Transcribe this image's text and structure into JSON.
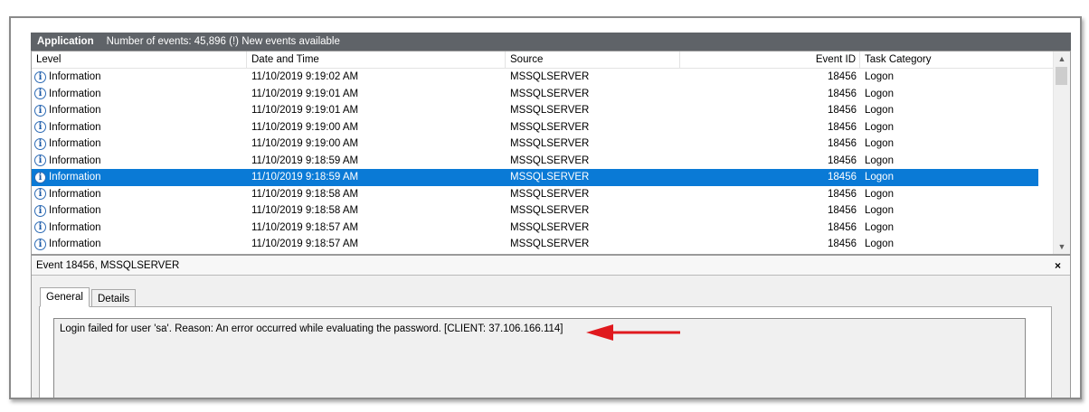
{
  "header": {
    "title": "Application",
    "subtitle": "Number of events: 45,896 (!) New events available"
  },
  "columns": {
    "level": "Level",
    "datetime": "Date and Time",
    "source": "Source",
    "event_id": "Event ID",
    "task_category": "Task Category"
  },
  "rows": [
    {
      "level": "Information",
      "datetime": "11/10/2019 9:19:02 AM",
      "source": "MSSQLSERVER",
      "event_id": "18456",
      "category": "Logon"
    },
    {
      "level": "Information",
      "datetime": "11/10/2019 9:19:01 AM",
      "source": "MSSQLSERVER",
      "event_id": "18456",
      "category": "Logon"
    },
    {
      "level": "Information",
      "datetime": "11/10/2019 9:19:01 AM",
      "source": "MSSQLSERVER",
      "event_id": "18456",
      "category": "Logon"
    },
    {
      "level": "Information",
      "datetime": "11/10/2019 9:19:00 AM",
      "source": "MSSQLSERVER",
      "event_id": "18456",
      "category": "Logon"
    },
    {
      "level": "Information",
      "datetime": "11/10/2019 9:19:00 AM",
      "source": "MSSQLSERVER",
      "event_id": "18456",
      "category": "Logon"
    },
    {
      "level": "Information",
      "datetime": "11/10/2019 9:18:59 AM",
      "source": "MSSQLSERVER",
      "event_id": "18456",
      "category": "Logon"
    },
    {
      "level": "Information",
      "datetime": "11/10/2019 9:18:59 AM",
      "source": "MSSQLSERVER",
      "event_id": "18456",
      "category": "Logon",
      "selected": true
    },
    {
      "level": "Information",
      "datetime": "11/10/2019 9:18:58 AM",
      "source": "MSSQLSERVER",
      "event_id": "18456",
      "category": "Logon"
    },
    {
      "level": "Information",
      "datetime": "11/10/2019 9:18:58 AM",
      "source": "MSSQLSERVER",
      "event_id": "18456",
      "category": "Logon"
    },
    {
      "level": "Information",
      "datetime": "11/10/2019 9:18:57 AM",
      "source": "MSSQLSERVER",
      "event_id": "18456",
      "category": "Logon"
    },
    {
      "level": "Information",
      "datetime": "11/10/2019 9:18:57 AM",
      "source": "MSSQLSERVER",
      "event_id": "18456",
      "category": "Logon"
    }
  ],
  "detail": {
    "title": "Event 18456, MSSQLSERVER",
    "close_label": "×",
    "tabs": [
      "General",
      "Details"
    ],
    "message": "Login failed for user 'sa'. Reason: An error occurred while evaluating the password. [CLIENT: 37.106.166.114]"
  },
  "icons": {
    "info": "information-icon",
    "scroll_up": "chevron-up-icon",
    "scroll_down": "chevron-down-icon",
    "close": "close-icon",
    "annotation": "red-arrow-icon"
  },
  "colors": {
    "header_bar": "#5f6368",
    "selection": "#0a7ad6",
    "info_icon": "#2d6bb5",
    "annotation_arrow": "#e0191e"
  }
}
